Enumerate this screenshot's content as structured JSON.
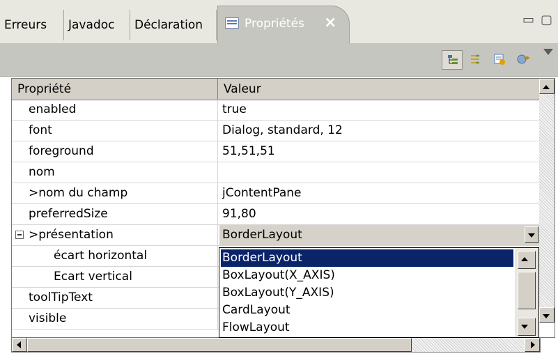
{
  "tabs": [
    {
      "label": "Erreurs"
    },
    {
      "label": "Javadoc"
    },
    {
      "label": "Déclaration"
    }
  ],
  "active_tab": {
    "label": "Propriétés",
    "icon": "properties-icon",
    "close": "×"
  },
  "window_controls": {
    "minimize": "▭",
    "maximize": "▢"
  },
  "toolbar": {
    "buttons": [
      {
        "icon": "show-categories-icon",
        "pressed": true
      },
      {
        "icon": "show-advanced-icon",
        "pressed": false
      },
      {
        "icon": "restore-default-icon",
        "pressed": false
      },
      {
        "icon": "filter-icon",
        "pressed": false
      }
    ],
    "menu_icon": "view-menu-icon"
  },
  "table": {
    "headers": {
      "property": "Propriété",
      "value": "Valeur"
    },
    "rows": [
      {
        "name": "enabled",
        "value": "true"
      },
      {
        "name": "font",
        "value": "Dialog, standard, 12"
      },
      {
        "name": "foreground",
        "value": "51,51,51"
      },
      {
        "name": "nom",
        "value": ""
      },
      {
        "name": ">nom du champ",
        "value": "jContentPane"
      },
      {
        "name": "preferredSize",
        "value": "91,80"
      },
      {
        "name": ">présentation",
        "value": "BorderLayout",
        "expanded": true,
        "editing": true
      },
      {
        "name": "écart horizontal",
        "value": ""
      },
      {
        "name": "Ecart vertical",
        "value": ""
      },
      {
        "name": "toolTipText",
        "value": ""
      },
      {
        "name": "visible",
        "value": ""
      }
    ]
  },
  "dropdown": {
    "selected": "BorderLayout",
    "options": [
      "BorderLayout",
      "BoxLayout(X_AXIS)",
      "BoxLayout(Y_AXIS)",
      "CardLayout",
      "FlowLayout"
    ]
  },
  "colors": {
    "selection": "#0a246a",
    "tab_bar": "#e9e8e0",
    "toolbar": "#c6c6c0"
  }
}
